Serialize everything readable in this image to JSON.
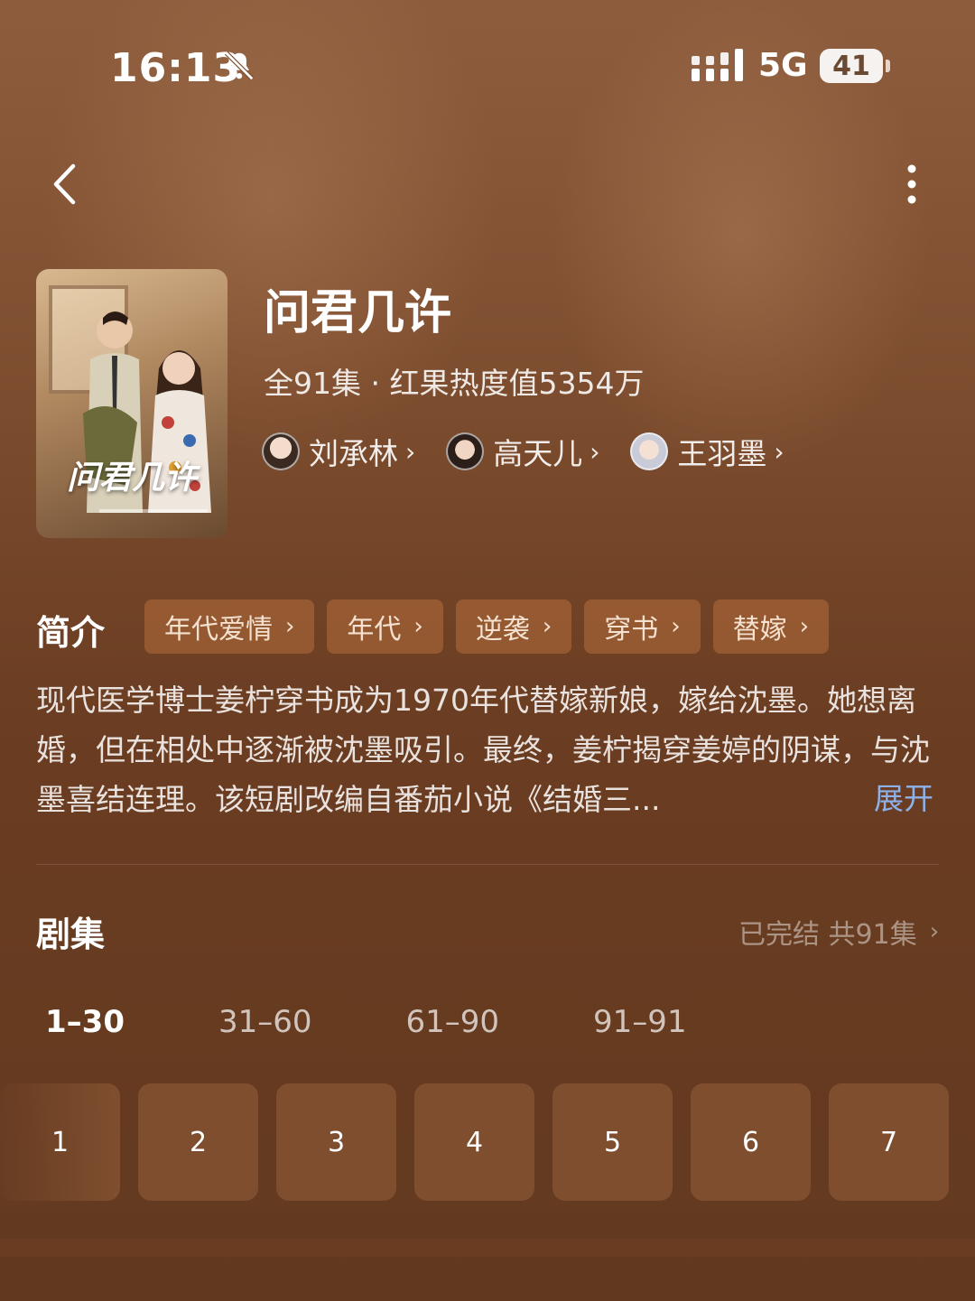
{
  "status_bar": {
    "time": "16:13",
    "network": "5G",
    "battery": "41"
  },
  "drama": {
    "title": "问君几许",
    "meta": "全91集 · 红果热度值5354万",
    "poster_title": "问君几许",
    "cast": [
      {
        "name": "刘承林"
      },
      {
        "name": "高天儿"
      },
      {
        "name": "王羽墨"
      }
    ]
  },
  "intro": {
    "heading": "简介",
    "tags": [
      "年代爱情",
      "年代",
      "逆袭",
      "穿书",
      "替嫁"
    ],
    "description": "现代医学博士姜柠穿书成为1970年代替嫁新娘，嫁给沈墨。她想离婚，但在相处中逐渐被沈墨吸引。最终，姜柠揭穿姜婷的阴谋，与沈墨喜结连理。该短剧改编自番茄小说《结婚三...",
    "expand_label": "展开"
  },
  "episodes": {
    "heading": "剧集",
    "status": "已完结 共91集",
    "ranges": [
      "1–30",
      "31–60",
      "61–90",
      "91–91"
    ],
    "active_range": 0,
    "items": [
      "1",
      "2",
      "3",
      "4",
      "5",
      "6",
      "7"
    ]
  },
  "colors": {
    "accent_link": "#8fb1ea",
    "background": "#6b3d22"
  }
}
